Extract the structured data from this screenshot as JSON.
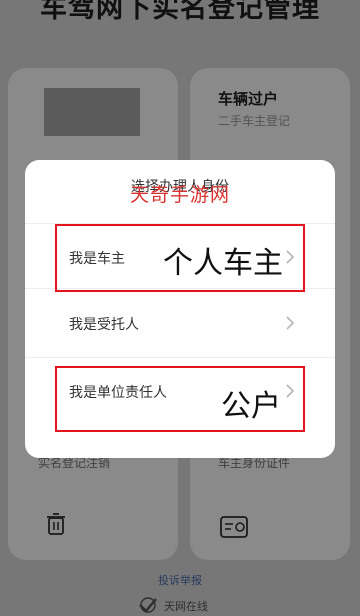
{
  "background": {
    "page_title": "车驾网下实名登记管理",
    "right_card": {
      "title": "车辆过户",
      "subtitle": "二手车主登记"
    },
    "left_bottom_label": "实名登记注销",
    "right_bottom_label": "车主身份证件",
    "report_link": "投诉举报",
    "footer_text": "天网在线"
  },
  "dialog": {
    "title": "选择办理人身份",
    "watermark": "天奇手游网",
    "options": [
      {
        "label": "我是车主",
        "annotation": "个人车主"
      },
      {
        "label": "我是受托人",
        "annotation": ""
      },
      {
        "label": "我是单位责任人",
        "annotation": "公户"
      }
    ]
  },
  "colors": {
    "overlay": "rgba(0,0,0,0.46)",
    "highlight_red": "#e3141f",
    "watermark_red": "#d8322e",
    "link_blue": "#4a6fb0"
  },
  "icons": [
    "trash-icon",
    "id-card-icon",
    "chevron-right-icon",
    "logo-icon"
  ]
}
